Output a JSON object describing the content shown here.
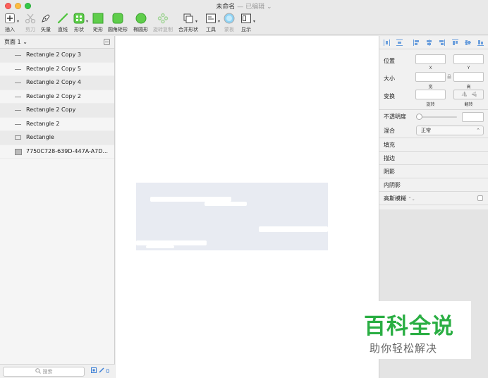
{
  "window": {
    "title": "未命名",
    "title_separator": "—",
    "edited_status": "已编辑",
    "edited_caret": "⌄"
  },
  "toolbar": {
    "items": [
      {
        "label": "插入",
        "icon": "plus-icon",
        "enabled": true
      },
      {
        "label": "剪刀",
        "icon": "scissors-icon",
        "enabled": false
      },
      {
        "label": "矢量",
        "icon": "pen-icon",
        "enabled": true
      },
      {
        "label": "直线",
        "icon": "line-icon",
        "enabled": true
      },
      {
        "label": "形状",
        "icon": "shapes-icon",
        "enabled": true
      },
      {
        "label": "矩形",
        "icon": "rectangle-icon",
        "enabled": true
      },
      {
        "label": "圆角矩形",
        "icon": "rounded-rectangle-icon",
        "enabled": true
      },
      {
        "label": "椭圆形",
        "icon": "oval-icon",
        "enabled": true
      },
      {
        "label": "旋转复制",
        "icon": "rotate-copy-icon",
        "enabled": false
      },
      {
        "label": "合并形状",
        "icon": "combine-shapes-icon",
        "enabled": true
      },
      {
        "label": "工具",
        "icon": "tools-icon",
        "enabled": true
      },
      {
        "label": "蒙板",
        "icon": "mask-icon",
        "enabled": false
      },
      {
        "label": "显示",
        "icon": "view-icon",
        "enabled": true
      }
    ],
    "colors": {
      "green": "#4cc33b",
      "blue": "#3f7fd8"
    }
  },
  "layers_panel": {
    "page_name": "页面 1",
    "page_caret": "⌄",
    "layers": [
      {
        "name": "Rectangle 2 Copy 3",
        "icon": "line-layer-icon"
      },
      {
        "name": "Rectangle 2 Copy 5",
        "icon": "line-layer-icon"
      },
      {
        "name": "Rectangle 2 Copy 4",
        "icon": "line-layer-icon"
      },
      {
        "name": "Rectangle 2 Copy 2",
        "icon": "line-layer-icon"
      },
      {
        "name": "Rectangle 2 Copy",
        "icon": "line-layer-icon"
      },
      {
        "name": "Rectangle 2",
        "icon": "line-layer-icon"
      },
      {
        "name": "Rectangle",
        "icon": "rectangle-layer-icon"
      },
      {
        "name": "7750C728-639D-447A-A7D...",
        "icon": "image-layer-icon"
      }
    ],
    "search_placeholder": "搜索",
    "slice_count": "0"
  },
  "inspector": {
    "position_label": "位置",
    "x_label": "X",
    "y_label": "Y",
    "size_label": "大小",
    "width_label": "宽",
    "height_label": "高",
    "transform_label": "变换",
    "rotate_label": "旋转",
    "flip_label": "翻转",
    "opacity_label": "不透明度",
    "blend_label": "混合",
    "blend_value": "正常",
    "fill_label": "填充",
    "border_label": "描边",
    "shadow_label": "阴影",
    "inner_shadow_label": "内阴影",
    "blur_label": "高斯模糊",
    "blur_caret": "⌃⌄"
  },
  "watermark": {
    "title": "百科全说",
    "subtitle": "助你轻松解决",
    "color": "#2aae43"
  }
}
